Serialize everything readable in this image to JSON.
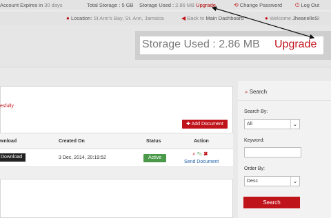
{
  "topbar": {
    "account_expires_label": "Account Expires in",
    "account_expires_value": "30 days",
    "total_storage": "Total Storage : 5 GB",
    "storage_used_label": "Storage Used :",
    "storage_used_value": "2.86 MB",
    "upgrade": "Upgrade",
    "change_password": "Change Password",
    "logout": "Log Out"
  },
  "secondbar": {
    "location_label": "Location:",
    "location_value": "St Ann's Bay, St. Ann, Jamaica",
    "back_prefix": "Back to",
    "back_target": "Main Dashboard",
    "welcome_label": "Welcome",
    "welcome_user": "JheanelleS!"
  },
  "storage_highlight": {
    "label": "Storage Used :",
    "value": "2.86 MB",
    "upgrade": "Upgrade"
  },
  "main": {
    "success_message": "esfully",
    "add_document": "Add Document",
    "table": {
      "headers": [
        "wnload",
        "Created On",
        "Status",
        "Action"
      ],
      "rows": [
        {
          "download": "Download",
          "created_on": "3 Dec, 2014, 20:19:52",
          "status": "Active",
          "send": "Send Document"
        }
      ]
    }
  },
  "search": {
    "title": "Search",
    "search_by_label": "Search By:",
    "search_by_value": "All",
    "keyword_label": "Keyword:",
    "keyword_value": "",
    "order_by_label": "Order By:",
    "order_by_value": "Desc",
    "button": "Search"
  },
  "colors": {
    "accent_red": "#c0141b",
    "active_green": "#4a9a4a",
    "link_blue": "#1f5fa6"
  }
}
